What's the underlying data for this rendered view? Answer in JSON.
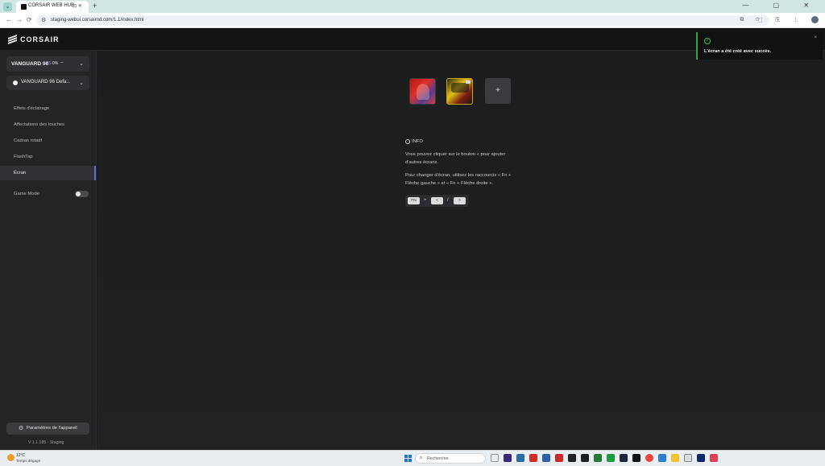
{
  "browser": {
    "tab_title": "CORSAIR WEB HUB",
    "tab_icons": "⊡ ✕",
    "new_tab": "+",
    "window_controls": "— ▢ ✕",
    "back": "←",
    "forward": "→",
    "reload": "⟳",
    "site_info": "⚙",
    "url": "staging-webui.corsairnd.com/1.1/index.html",
    "omnibox_icons": "⧉ ☆",
    "toolbar_icons": "⬚ ⎘ ⋮"
  },
  "header": {
    "brand": "CORSAIR"
  },
  "sidebar": {
    "device": {
      "name": "VANGUARD 96",
      "firmware": "HS",
      "battery": "0%",
      "connection": "⌔",
      "chevron": "⌄"
    },
    "profile": {
      "name": "VANGUARD 96 Defa...",
      "chevron": "⌄"
    },
    "menu": [
      {
        "label": "Effets d'éclairage"
      },
      {
        "label": "Affectations des touches"
      },
      {
        "label": "Cadran rotatif"
      },
      {
        "label": "FlashTap"
      },
      {
        "label": "Écran"
      }
    ],
    "game_mode": {
      "label": "Game Mode",
      "enabled": false
    },
    "settings_button": "Paramètres de l'appareil",
    "settings_icon": "⚙",
    "version": "V 1.1.185 - Staging"
  },
  "main": {
    "add_button": "+",
    "info": {
      "title": "INFO",
      "paragraph1": "Vous pouvez cliquer sur le bouton « pour ajouter d'autres écrans.",
      "paragraph2": "Pour changer d'écran, utilisez les raccourcis « Fn + Flèche gauche » et « Fn + Flèche droite »."
    },
    "shortcut": {
      "fn": "FN",
      "plus": "+",
      "left": "<",
      "slash": "/",
      "right": ">"
    }
  },
  "toast": {
    "icon": "✓",
    "message": "L'écran a été créé avec succès.",
    "close": "×"
  },
  "taskbar": {
    "weather_temp": "12°C",
    "weather_desc": "Temps dégagé",
    "search_icon": "⌕",
    "search_placeholder": "Rechercher"
  },
  "colors": {
    "accent": "#5a73c8",
    "success": "#27a844",
    "background": "#1a1b1d"
  }
}
